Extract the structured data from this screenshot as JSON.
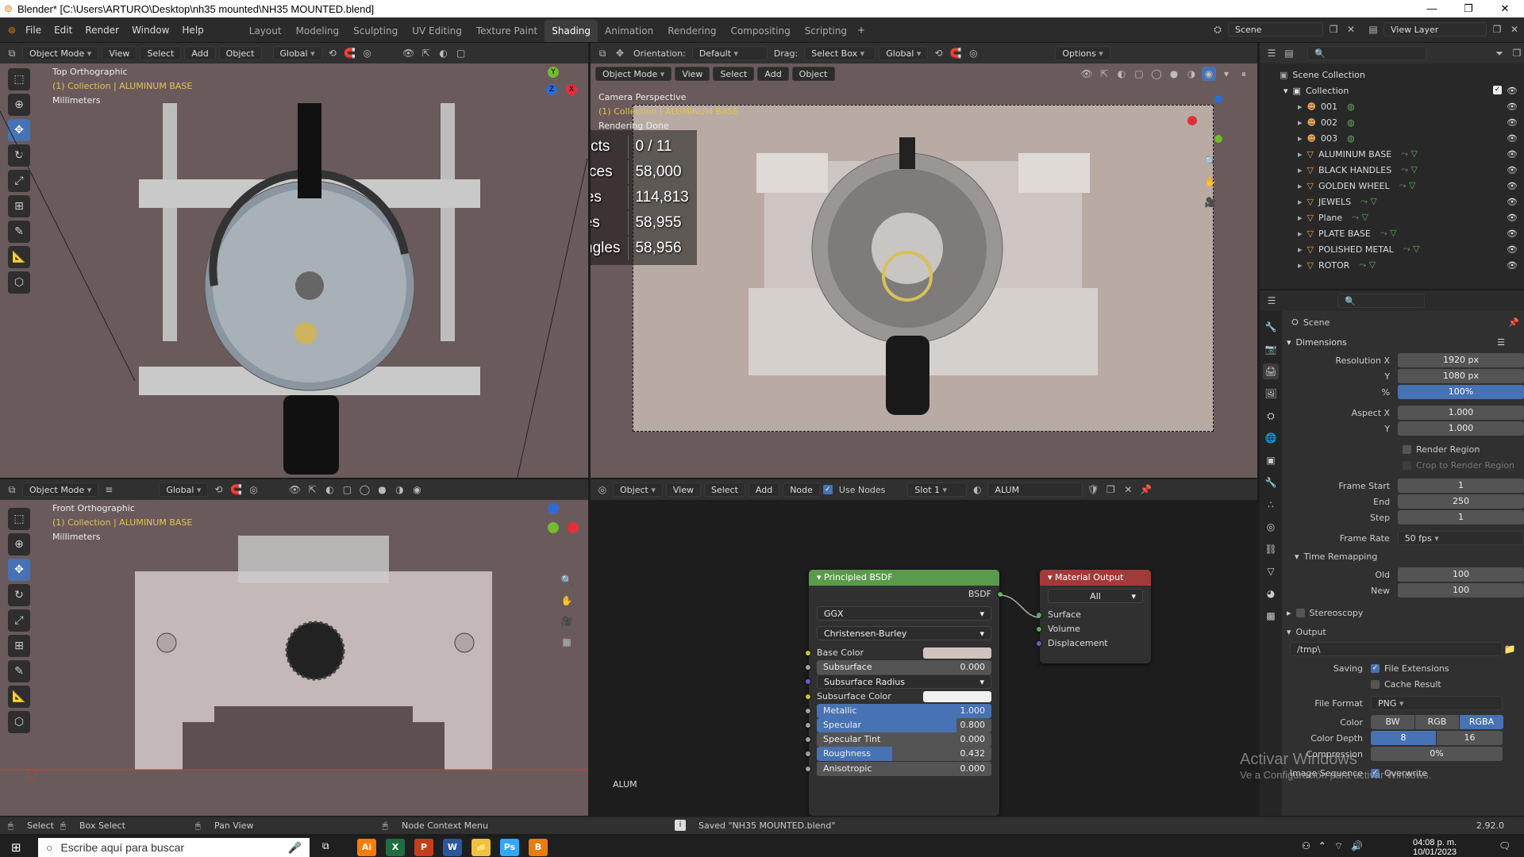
{
  "window": {
    "title": "Blender* [C:\\Users\\ARTURO\\Desktop\\nh35 mounted\\NH35 MOUNTED.blend]"
  },
  "menus": [
    "File",
    "Edit",
    "Render",
    "Window",
    "Help"
  ],
  "workspaces": [
    "Layout",
    "Modeling",
    "Sculpting",
    "UV Editing",
    "Texture Paint",
    "Shading",
    "Animation",
    "Rendering",
    "Compositing",
    "Scripting"
  ],
  "active_workspace": "Shading",
  "scene": {
    "label": "Scene",
    "view_layer": "View Layer"
  },
  "vp_top": {
    "mode": "Object Mode",
    "menus": [
      "View",
      "Select",
      "Add",
      "Object"
    ],
    "transform": "Global",
    "view_name": "Top Orthographic",
    "collection": "(1) Collection | ALUMINUM BASE",
    "units": "Millimeters",
    "axis": {
      "x": "X",
      "y": "Y",
      "z": "Z"
    }
  },
  "vp_cam": {
    "mode": "Object Mode",
    "menus": [
      "View",
      "Select",
      "Add",
      "Object"
    ],
    "orientation_label": "Orientation:",
    "orientation": "Default",
    "drag_label": "Drag:",
    "drag": "Select Box",
    "transform": "Global",
    "options": "Options",
    "view_name": "Camera Perspective",
    "collection": "(1) Collection | ALUMINUM BASE",
    "status": "Rendering Done",
    "stats": [
      {
        "k": "Objects",
        "v": "0 / 11"
      },
      {
        "k": "Vertices",
        "v": "58,000"
      },
      {
        "k": "Edges",
        "v": "114,813"
      },
      {
        "k": "Faces",
        "v": "58,955"
      },
      {
        "k": "Triangles",
        "v": "58,956"
      }
    ]
  },
  "vp_front": {
    "mode": "Object Mode",
    "transform": "Global",
    "view_name": "Front Orthographic",
    "collection": "(1) Collection | ALUMINUM BASE",
    "units": "Millimeters"
  },
  "node_editor": {
    "type": "Object",
    "menus": [
      "View",
      "Select",
      "Add",
      "Node"
    ],
    "use_nodes": "Use Nodes",
    "slot": "Slot 1",
    "material": "ALUM",
    "footer_material": "ALUM",
    "bsdf": {
      "title": "Principled BSDF",
      "out": "BSDF",
      "distribution": "GGX",
      "subsurface_method": "Christensen-Burley",
      "rows": [
        {
          "label": "Base Color",
          "kind": "color",
          "color": "#d1c4be"
        },
        {
          "label": "Subsurface",
          "kind": "value",
          "value": "0.000",
          "fill": 0
        },
        {
          "label": "Subsurface Radius",
          "kind": "drop"
        },
        {
          "label": "Subsurface Color",
          "kind": "color",
          "color": "#f0f0f0"
        },
        {
          "label": "Metallic",
          "kind": "value",
          "value": "1.000",
          "fill": 1
        },
        {
          "label": "Specular",
          "kind": "value",
          "value": "0.800",
          "fill": 0.8
        },
        {
          "label": "Specular Tint",
          "kind": "value",
          "value": "0.000",
          "fill": 0
        },
        {
          "label": "Roughness",
          "kind": "value",
          "value": "0.432",
          "fill": 0.432
        },
        {
          "label": "Anisotropic",
          "kind": "value",
          "value": "0.000",
          "fill": 0
        }
      ]
    },
    "output": {
      "title": "Material Output",
      "target": "All",
      "inputs": [
        "Surface",
        "Volume",
        "Displacement"
      ]
    }
  },
  "outliner": {
    "root": "Scene Collection",
    "collection": "Collection",
    "items": [
      "001",
      "002",
      "003",
      "ALUMINUM BASE",
      "BLACK HANDLES",
      "GOLDEN WHEEL",
      "JEWELS",
      "Plane",
      "PLATE BASE",
      "POLISHED METAL",
      "ROTOR"
    ]
  },
  "properties": {
    "context": "Scene",
    "dimensions": "Dimensions",
    "res_x_label": "Resolution X",
    "res_x": "1920 px",
    "res_y_label": "Y",
    "res_y": "1080 px",
    "pct_label": "%",
    "pct": "100%",
    "aspect_x_label": "Aspect X",
    "aspect_x": "1.000",
    "aspect_y_label": "Y",
    "aspect_y": "1.000",
    "render_region": "Render Region",
    "crop": "Crop to Render Region",
    "frame_start_label": "Frame Start",
    "frame_start": "1",
    "end_label": "End",
    "end": "250",
    "step_label": "Step",
    "step": "1",
    "frame_rate_label": "Frame Rate",
    "frame_rate": "50 fps",
    "time_remap": "Time Remapping",
    "old_label": "Old",
    "old": "100",
    "new_label": "New",
    "new": "100",
    "stereoscopy": "Stereoscopy",
    "output": "Output",
    "path": "/tmp\\",
    "saving_label": "Saving",
    "file_ext": "File Extensions",
    "cache": "Cache Result",
    "format_label": "File Format",
    "format": "PNG",
    "color_label": "Color",
    "color_opts": [
      "BW",
      "RGB",
      "RGBA"
    ],
    "depth_label": "Color Depth",
    "depth_opts": [
      "8",
      "16"
    ],
    "compression_label": "Compression",
    "compression": "0%",
    "img_seq_label": "Image Sequence",
    "overwrite": "Overwrite"
  },
  "watermark": {
    "line1": "Activar Windows",
    "line2": "Ve a Configuración para activar Windows."
  },
  "statusbar": {
    "select": "Select",
    "box_select": "Box Select",
    "pan": "Pan View",
    "node_menu": "Node Context Menu",
    "saved": "Saved \"NH35 MOUNTED.blend\"",
    "version": "2.92.0"
  },
  "taskbar": {
    "search": "Escribe aquí para buscar",
    "time": "04:08 p. m.",
    "date": "10/01/2023",
    "apps": [
      "Ai",
      "X",
      "P",
      "W",
      "📁",
      "Ps",
      "B"
    ]
  }
}
